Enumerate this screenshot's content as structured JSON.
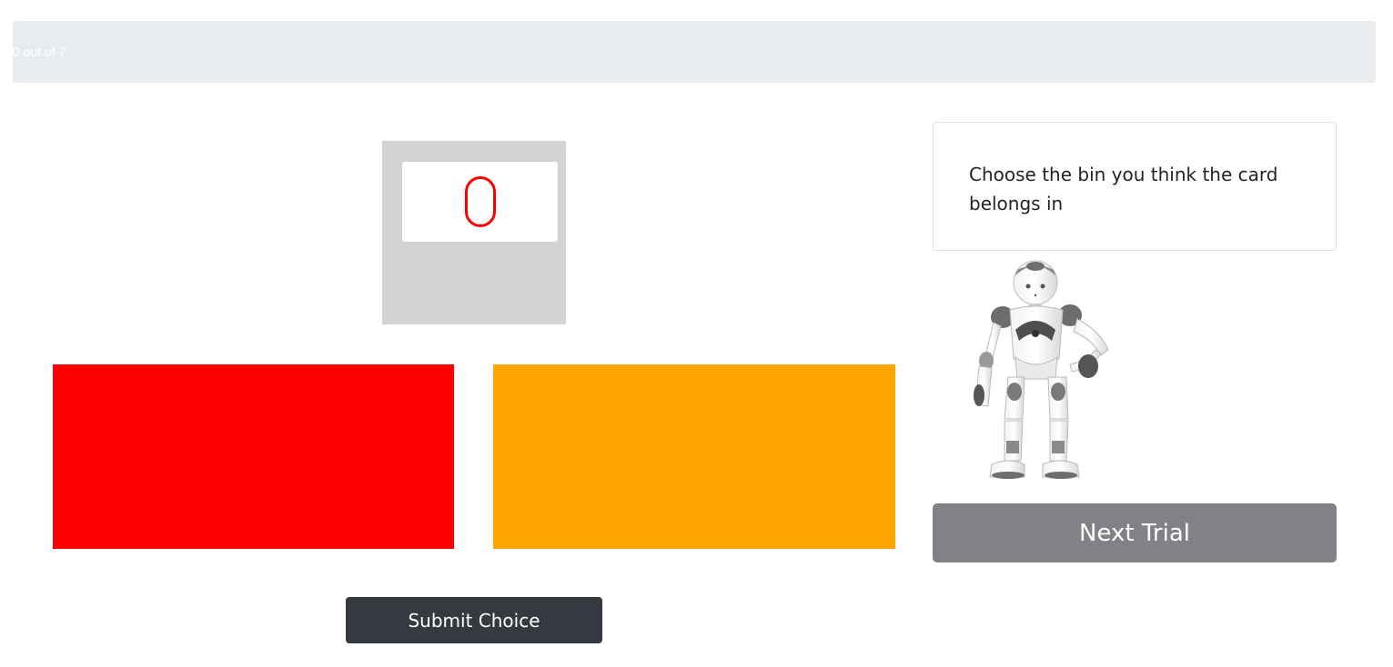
{
  "progress": {
    "label": "0 out of 7",
    "completed": 0,
    "total": 7
  },
  "card": {
    "shape": "oval-outline",
    "symbol_count": 1,
    "color": "#ff0000"
  },
  "bins": [
    {
      "color": "#ff0000"
    },
    {
      "color": "#ffa500"
    }
  ],
  "submit": {
    "label": "Submit Choice"
  },
  "instruction": {
    "text": "Choose the bin you think the card belongs in"
  },
  "robot": {
    "icon": "humanoid-robot-icon"
  },
  "next": {
    "label": "Next Trial"
  }
}
